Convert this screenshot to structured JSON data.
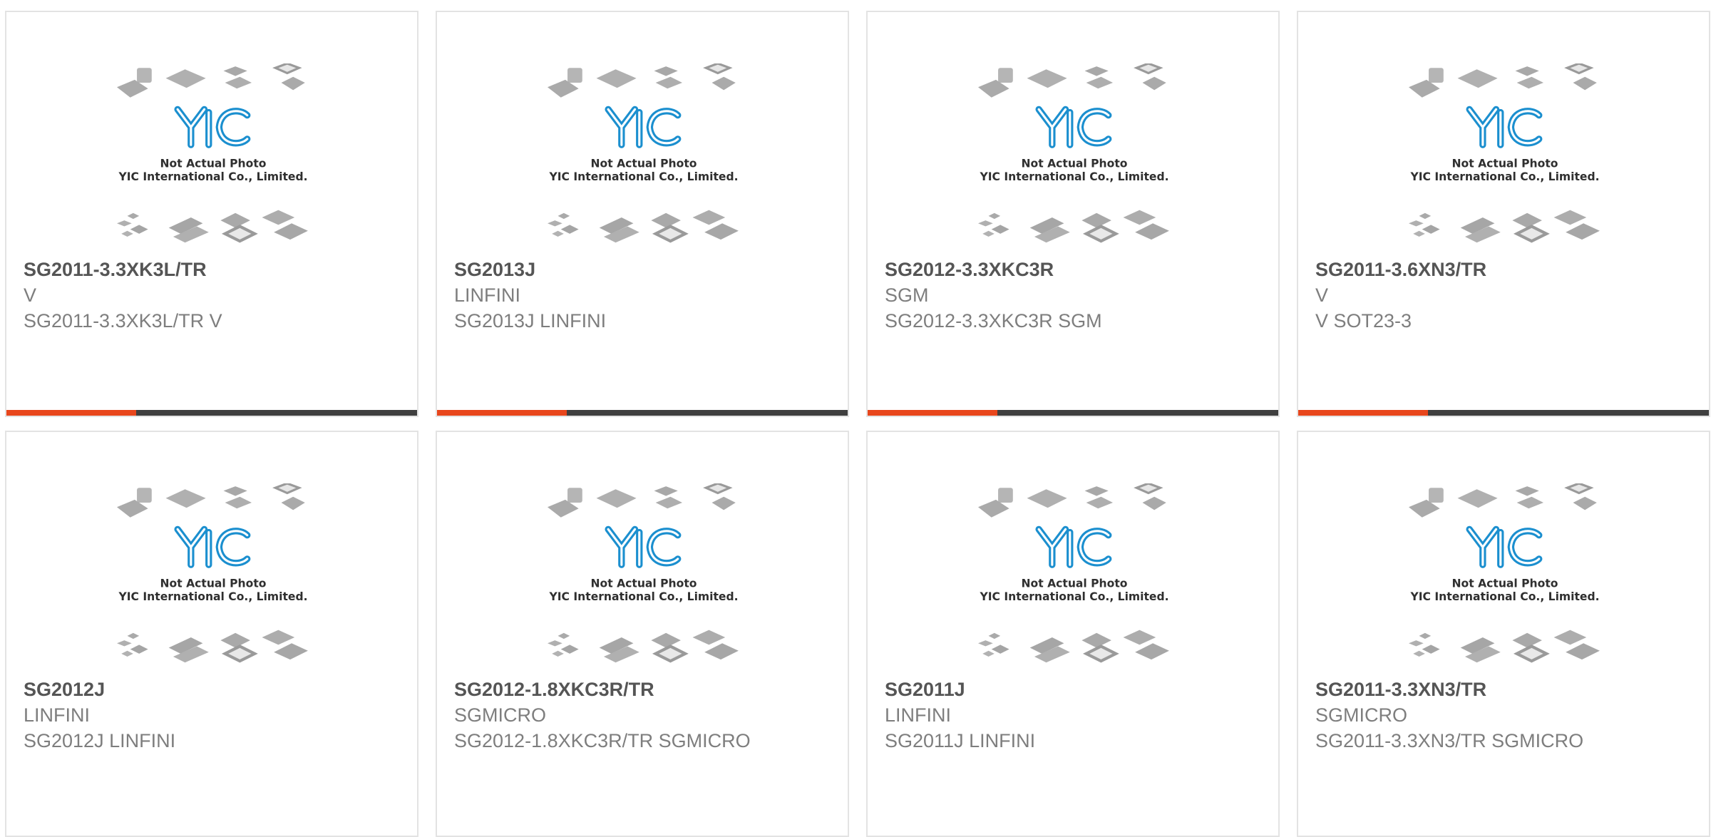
{
  "colors": {
    "accent": "#e8461c",
    "bar_dark": "#3f3f3f",
    "logo_blue": "#1b8fcf",
    "chip_gray": "#a9a9a9"
  },
  "placeholder_image": {
    "line1": "Not Actual Photo",
    "line2": "YIC International Co., Limited.",
    "logo_icon": "yic-logo"
  },
  "products": [
    {
      "part_number": "SG2011-3.3XK3L/TR",
      "manufacturer": "V",
      "description": "SG2011-3.3XK3L/TR V",
      "has_accent_bar": true
    },
    {
      "part_number": "SG2013J",
      "manufacturer": "LINFINI",
      "description": "SG2013J LINFINI",
      "has_accent_bar": true
    },
    {
      "part_number": "SG2012-3.3XKC3R",
      "manufacturer": "SGM",
      "description": "SG2012-3.3XKC3R SGM",
      "has_accent_bar": true
    },
    {
      "part_number": "SG2011-3.6XN3/TR",
      "manufacturer": "V",
      "description": "V SOT23-3",
      "has_accent_bar": true
    },
    {
      "part_number": "SG2012J",
      "manufacturer": "LINFINI",
      "description": "SG2012J LINFINI",
      "has_accent_bar": false
    },
    {
      "part_number": "SG2012-1.8XKC3R/TR",
      "manufacturer": "SGMICRO",
      "description": "SG2012-1.8XKC3R/TR SGMICRO",
      "has_accent_bar": false
    },
    {
      "part_number": "SG2011J",
      "manufacturer": "LINFINI",
      "description": "SG2011J LINFINI",
      "has_accent_bar": false
    },
    {
      "part_number": "SG2011-3.3XN3/TR",
      "manufacturer": "SGMICRO",
      "description": "SG2011-3.3XN3/TR SGMICRO",
      "has_accent_bar": false
    }
  ]
}
